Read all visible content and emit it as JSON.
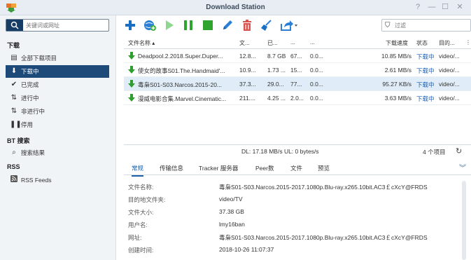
{
  "window": {
    "title": "Download Station",
    "controls": [
      "?",
      "—",
      "☐",
      "✕"
    ]
  },
  "sidebar": {
    "search_placeholder": "关键词或网址",
    "sections": [
      {
        "header": "下载"
      },
      {
        "header": "BT 搜索"
      },
      {
        "header": "RSS"
      }
    ],
    "items": [
      {
        "label": "全部下载项目",
        "icon": "all-downloads-icon"
      },
      {
        "label": "下载中",
        "icon": "downloading-icon",
        "active": true
      },
      {
        "label": "已完成",
        "icon": "checkmark-icon"
      },
      {
        "label": "进行中",
        "icon": "active-arrows-icon"
      },
      {
        "label": "非进行中",
        "icon": "inactive-icon"
      },
      {
        "label": "停用",
        "icon": "pause-icon"
      },
      {
        "label": "搜索结果",
        "icon": "search-icon"
      },
      {
        "label": "RSS Feeds",
        "icon": "rss-icon"
      }
    ]
  },
  "toolbar": {
    "buttons": [
      "add-icon",
      "add-url-icon",
      "resume-icon",
      "pause-icon",
      "stop-icon",
      "edit-icon",
      "delete-icon",
      "clear-icon",
      "share-icon"
    ],
    "filter_placeholder": "过滤"
  },
  "table": {
    "columns": [
      "文件名称 ▴",
      "文...",
      "已...",
      "...",
      "...",
      "下载速度",
      "状态",
      "目的...",
      "⋮"
    ],
    "rows": [
      {
        "name": "Deadpool.2.2018.Super.Duper...",
        "size": "12.8...",
        "done": "8.7 GB",
        "pct": "67...",
        "upload": "0.0...",
        "speed": "10.85 MB/s",
        "status": "下载中",
        "dest": "video/..."
      },
      {
        "name": "使女的故事S01.The.Handmaid'...",
        "size": "10.9...",
        "done": "1.73 ...",
        "pct": "15...",
        "upload": "0.0...",
        "speed": "2.61 MB/s",
        "status": "下载中",
        "dest": "video/..."
      },
      {
        "name": "毒枭S01-S03.Narcos.2015-20...",
        "size": "37.3...",
        "done": "29.0...",
        "pct": "77...",
        "upload": "0.0...",
        "speed": "95.27 KB/s",
        "status": "下载中",
        "dest": "video/...",
        "selected": true
      },
      {
        "name": "漫威电影合集.Marvel.Cinematic...",
        "size": "211....",
        "done": "4.25 ...",
        "pct": "2.0...",
        "upload": "0.0...",
        "speed": "3.63 MB/s",
        "status": "下载中",
        "dest": "video/..."
      }
    ]
  },
  "statusbar": {
    "speed": "DL: 17.18 MB/s  UL: 0 bytes/s",
    "count": "4 个项目"
  },
  "detail": {
    "tabs": [
      "常规",
      "传输信息",
      "Tracker 服务器",
      "Peer数",
      "文件",
      "预览"
    ],
    "rows": [
      {
        "key": "文件名称:",
        "value": "毒枭S01-S03.Narcos.2015-2017.1080p.Blu-ray.x265.10bit.AC3￡cXcY@FRDS"
      },
      {
        "key": "目的地文件夹:",
        "value": "video/TV"
      },
      {
        "key": "文件大小:",
        "value": "37.38 GB"
      },
      {
        "key": "用户名:",
        "value": "lmy16ban"
      },
      {
        "key": "网址:",
        "value": "毒枭S01-S03.Narcos.2015-2017.1080p.Blu-ray.x265.10bit.AC3￡cXcY@FRDS"
      },
      {
        "key": "创建时间:",
        "value": "2018-10-26 11:07:37"
      }
    ]
  },
  "colors": {
    "accent": "#1e4a7a",
    "download_green": "#2f9d2f",
    "status_blue": "#1a5fb4",
    "selected_row": "#e0ecf7"
  }
}
